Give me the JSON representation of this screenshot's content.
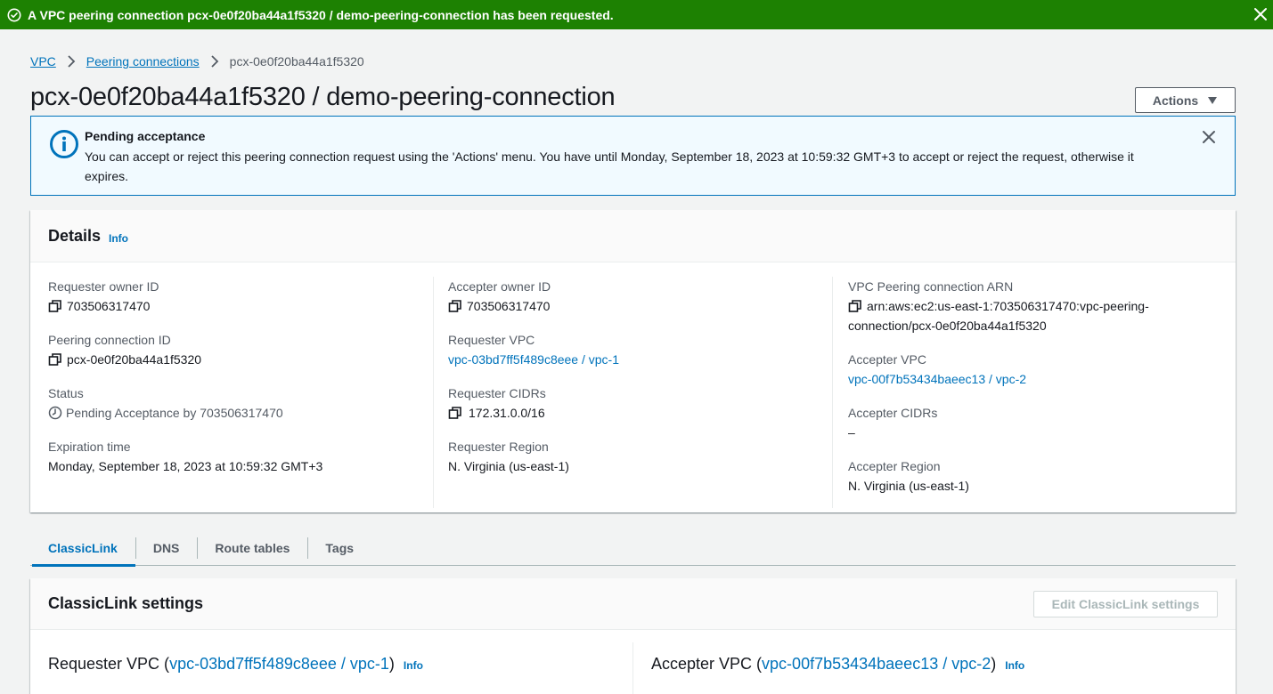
{
  "flash": {
    "message": "A VPC peering connection pcx-0e0f20ba44a1f5320 / demo-peering-connection has been requested.",
    "color": "#1d8102",
    "icon": "check-circle-icon"
  },
  "breadcrumb": {
    "items": [
      "VPC",
      "Peering connections"
    ],
    "current": "pcx-0e0f20ba44a1f5320"
  },
  "page": {
    "title": "pcx-0e0f20ba44a1f5320 / demo-peering-connection",
    "actions_label": "Actions"
  },
  "alert": {
    "title": "Pending acceptance",
    "body": "You can accept or reject this peering connection request using the 'Actions' menu. You have until Monday, September 18, 2023 at 10:59:32 GMT+3 to accept or reject the request, otherwise it expires."
  },
  "details": {
    "title": "Details",
    "info": "Info",
    "col1": {
      "requester_owner_label": "Requester owner ID",
      "requester_owner_value": "703506317470",
      "peering_id_label": "Peering connection ID",
      "peering_id_value": "pcx-0e0f20ba44a1f5320",
      "status_label": "Status",
      "status_value": "Pending Acceptance by 703506317470",
      "expiration_label": "Expiration time",
      "expiration_value": "Monday, September 18, 2023 at 10:59:32 GMT+3"
    },
    "col2": {
      "accepter_owner_label": "Accepter owner ID",
      "accepter_owner_value": "703506317470",
      "requester_vpc_label": "Requester VPC",
      "requester_vpc_value": "vpc-03bd7ff5f489c8eee / vpc-1",
      "requester_cidrs_label": "Requester CIDRs",
      "requester_cidrs_value": "172.31.0.0/16",
      "requester_region_label": "Requester Region",
      "requester_region_value": "N. Virginia (us-east-1)"
    },
    "col3": {
      "arn_label": "VPC Peering connection ARN",
      "arn_value_line1": "arn:aws:ec2:us-east-1:703506317470:vpc-peering-",
      "arn_value_line2": "connection/pcx-0e0f20ba44a1f5320",
      "accepter_vpc_label": "Accepter VPC",
      "accepter_vpc_value": "vpc-00f7b53434baeec13 / vpc-2",
      "accepter_cidrs_label": "Accepter CIDRs",
      "accepter_cidrs_value": "–",
      "accepter_region_label": "Accepter Region",
      "accepter_region_value": "N. Virginia (us-east-1)"
    }
  },
  "tabs": [
    "ClassicLink",
    "DNS",
    "Route tables",
    "Tags"
  ],
  "classiclink": {
    "title": "ClassicLink settings",
    "edit_label": "Edit ClassicLink settings",
    "requester_prefix": "Requester VPC (",
    "requester_link": "vpc-03bd7ff5f489c8eee / vpc-1",
    "accepter_prefix": "Accepter VPC (",
    "accepter_link": "vpc-00f7b53434baeec13 / vpc-2",
    "suffix": ")",
    "info": "Info"
  },
  "colors": {
    "link": "#0073bb",
    "success": "#1d8102",
    "info_bg": "#f1faff"
  }
}
